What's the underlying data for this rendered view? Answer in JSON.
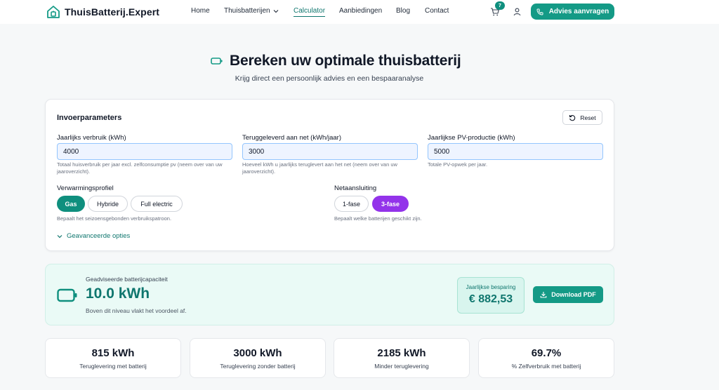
{
  "header": {
    "logo_text": "ThuisBatterij.Expert",
    "nav": {
      "home": "Home",
      "thuisbatterijen": "Thuisbatterijen",
      "calculator": "Calculator",
      "aanbiedingen": "Aanbiedingen",
      "blog": "Blog",
      "contact": "Contact"
    },
    "cart_count": "7",
    "cta_label": "Advies aanvragen"
  },
  "hero": {
    "title": "Bereken uw optimale thuisbatterij",
    "subtitle": "Krijg direct een persoonlijk advies en een bespaaranalyse"
  },
  "inputs": {
    "title": "Invoerparameters",
    "reset_label": "Reset",
    "fields": [
      {
        "label": "Jaarlijks verbruik (kWh)",
        "value": "4000",
        "help": "Totaal huisverbruik per jaar excl. zelfconsumptie pv (neem over van uw jaaroverzicht)."
      },
      {
        "label": "Teruggeleverd aan net (kWh/jaar)",
        "value": "3000",
        "help": "Hoeveel kWh u jaarlijks teruglevert aan het net (neem over van uw jaaroverzicht)."
      },
      {
        "label": "Jaarlijkse PV-productie (kWh)",
        "value": "5000",
        "help": "Totale PV-opwek per jaar."
      }
    ],
    "heating": {
      "label": "Verwarmingsprofiel",
      "options": [
        "Gas",
        "Hybride",
        "Full electric"
      ],
      "selected": "Gas",
      "help": "Bepaalt het seizoensgebonden verbruikspatroon."
    },
    "grid": {
      "label": "Netaansluiting",
      "options": [
        "1-fase",
        "3-fase"
      ],
      "selected": "3-fase",
      "help": "Bepaalt welke batterijen geschikt zijn."
    },
    "advanced_label": "Geavanceerde opties"
  },
  "result": {
    "label": "Geadviseerde batterijcapaciteit",
    "value": "10.0 kWh",
    "note": "Boven dit niveau vlakt het voordeel af.",
    "saving_label": "Jaarlijkse besparing",
    "saving_value": "€ 882,53",
    "pdf_label": "Download PDF"
  },
  "stats": [
    {
      "value": "815 kWh",
      "label": "Teruglevering met batterij"
    },
    {
      "value": "3000 kWh",
      "label": "Teruglevering zonder batterij"
    },
    {
      "value": "2185 kWh",
      "label": "Minder teruglevering"
    },
    {
      "value": "69.7%",
      "label": "% Zelfverbruik met batterij"
    }
  ],
  "colors": {
    "accent": "#149a86",
    "accent_dark": "#0f766e",
    "purple": "#9333ea",
    "result_bg": "#eafaf6"
  }
}
